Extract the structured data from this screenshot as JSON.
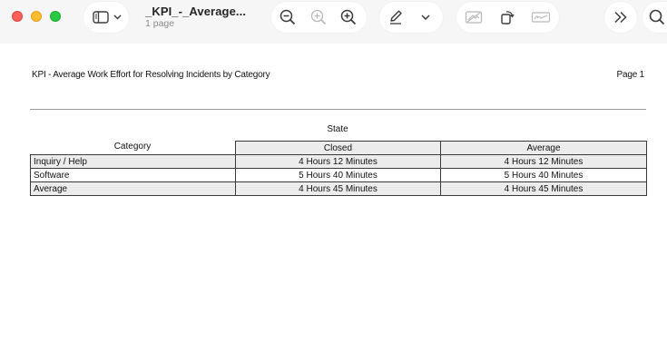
{
  "window": {
    "title": "_KPI_-_Average...",
    "subtitle": "1 page"
  },
  "toolbar": {
    "sidebar_toggle_icon": "sidebar-icon",
    "zoom_out_icon": "zoom-out-icon",
    "actual_size_icon": "zoom-actual-icon",
    "zoom_in_icon": "zoom-in-icon",
    "markup_icon": "pen-icon",
    "markup_menu_icon": "chevron-down-icon",
    "redact_icon": "redact-icon",
    "rotate_icon": "rotate-icon",
    "sign_icon": "signature-icon",
    "more_icon": "double-chevron-right-icon",
    "search_icon": "search-icon"
  },
  "document": {
    "report_title": "KPI - Average Work Effort for Resolving Incidents by Category",
    "page_label": "Page 1",
    "group_label": "State",
    "columns": [
      "Category",
      "Closed",
      "Average"
    ],
    "rows": [
      {
        "category": "Inquiry / Help",
        "closed": "4 Hours 12 Minutes",
        "average": "4 Hours 12 Minutes"
      },
      {
        "category": "Software",
        "closed": "5 Hours 40 Minutes",
        "average": "5 Hours 40 Minutes"
      },
      {
        "category": "Average",
        "closed": "4 Hours 45 Minutes",
        "average": "4 Hours 45 Minutes"
      }
    ]
  }
}
